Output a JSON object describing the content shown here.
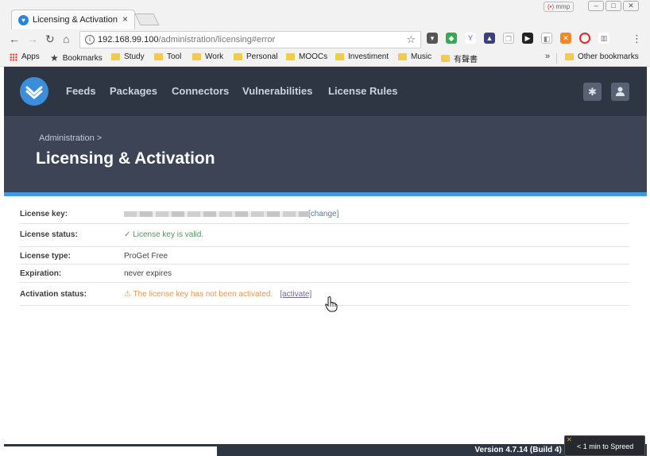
{
  "browser": {
    "tab_title": "Licensing & Activation",
    "tab_close": "×",
    "extension_label": "mmp",
    "url_host": "192.168.99.100",
    "url_path": "/administration/licensing#error",
    "window_buttons": [
      "–",
      "□",
      "✕"
    ]
  },
  "bookmarks": {
    "apps": "Apps",
    "bookmarks": "Bookmarks",
    "items": [
      "Study",
      "Tool",
      "Work",
      "Personal",
      "MOOCs",
      "Investiment",
      "Music",
      "有聲書"
    ],
    "more": "»",
    "other": "Other bookmarks"
  },
  "nav": {
    "items": [
      "Feeds",
      "Packages",
      "Connectors",
      "Vulnerabilities",
      "License Rules"
    ],
    "settings_icon": "gear-icon",
    "user_icon": "user-icon"
  },
  "header": {
    "breadcrumb": "Administration >",
    "title": "Licensing & Activation"
  },
  "license": {
    "key_label": "License key:",
    "key_change": "[change]",
    "status_label": "License status:",
    "status_value": "License key is valid.",
    "type_label": "License type:",
    "type_value": "ProGet Free",
    "expiration_label": "Expiration:",
    "expiration_value": "never expires",
    "activation_label": "Activation status:",
    "activation_value": "The license key has not been activated.",
    "activation_link": "[activate]"
  },
  "footer": {
    "version": "Version 4.7.14 (Build 4) -"
  },
  "spreed": {
    "text": "< 1 min to Spreed"
  },
  "colors": {
    "nav_bg": "#2e3644",
    "header_bg": "#3c4456",
    "accent": "#3d9ae8",
    "ok": "#55935b",
    "warn": "#e09658"
  }
}
